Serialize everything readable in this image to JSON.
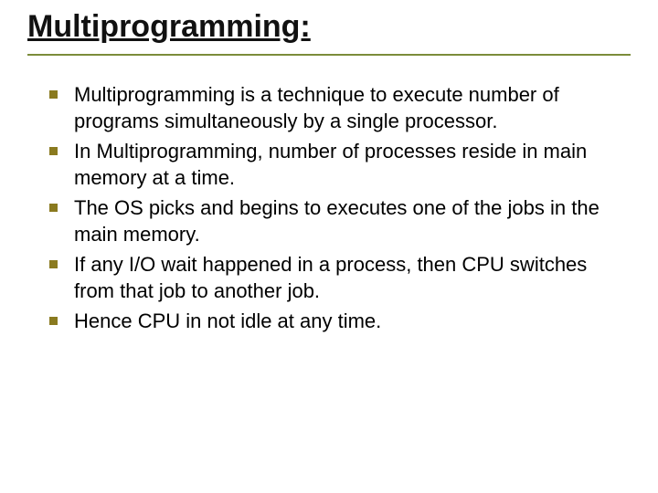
{
  "title": "Multiprogramming:",
  "bullets": [
    "Multiprogramming is a technique to execute number of programs simultaneously by a single processor.",
    "In Multiprogramming, number of processes reside in main memory at a time.",
    "The OS picks and begins to executes one of the jobs in the main memory.",
    "If any I/O wait happened in a process, then CPU switches from that job to another job.",
    "Hence CPU in not idle at any time."
  ]
}
